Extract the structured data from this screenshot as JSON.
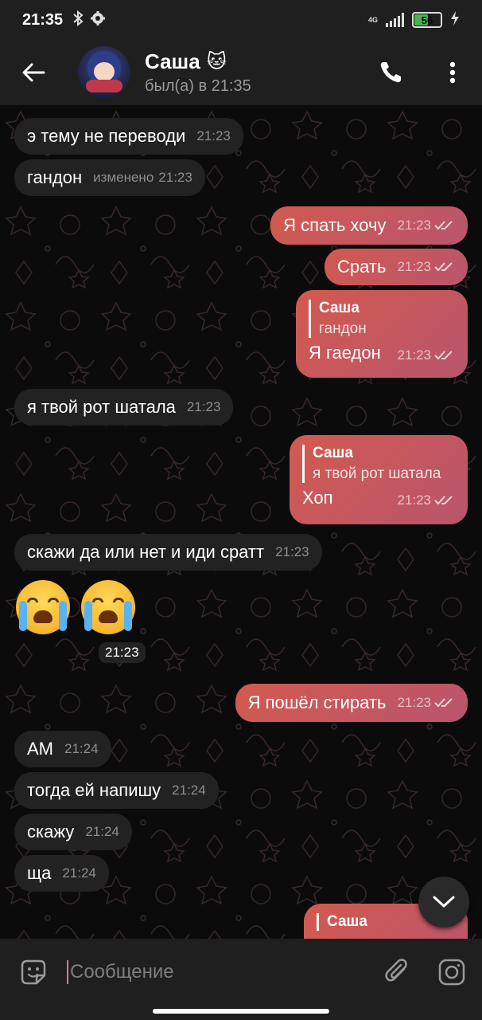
{
  "status_bar": {
    "time": "21:35",
    "network": "4G",
    "battery": "56",
    "battery_fill": 0.56
  },
  "header": {
    "name": "Саша",
    "name_emoji": "🐱",
    "status": "был(а) в 21:35"
  },
  "colors": {
    "bubble_in": "#222222",
    "bubble_out_start": "#d35a4e",
    "bubble_out_end": "#b8556e",
    "chat_bg": "#0b0b0b",
    "bar_bg": "#1f1f1f"
  },
  "messages": [
    {
      "dir": "in",
      "text": "э тему не переводи",
      "time": "21:23"
    },
    {
      "dir": "in",
      "text": "гандон",
      "edited": "изменено",
      "time": "21:23"
    },
    {
      "dir": "out",
      "text": "Я спать хочу",
      "time": "21:23"
    },
    {
      "dir": "out",
      "text": "Срать",
      "time": "21:23"
    },
    {
      "dir": "out",
      "reply_author": "Саша",
      "reply_text": "гандон",
      "text": "Я гаедон",
      "time": "21:23"
    },
    {
      "dir": "in",
      "text": "я твой рот шатала",
      "time": "21:23"
    },
    {
      "dir": "out",
      "reply_author": "Саша",
      "reply_text": "я твой рот шатала",
      "text": "Хоп",
      "time": "21:23"
    },
    {
      "dir": "in",
      "text": "скажи да или нет и иди сратт",
      "time": "21:23"
    },
    {
      "dir": "in",
      "emoji": "😭😭",
      "time": "21:23"
    },
    {
      "dir": "out",
      "text": "Я пошёл стирать",
      "time": "21:23"
    },
    {
      "dir": "in",
      "text": "АМ",
      "time": "21:24"
    },
    {
      "dir": "in",
      "text": "тогда ей напишу",
      "time": "21:24"
    },
    {
      "dir": "in",
      "text": "скажу",
      "time": "21:24"
    },
    {
      "dir": "in",
      "text": "ща",
      "time": "21:24"
    },
    {
      "dir": "out",
      "reply_author": "Саша",
      "partial": true
    }
  ],
  "input": {
    "placeholder": "Сообщение"
  }
}
